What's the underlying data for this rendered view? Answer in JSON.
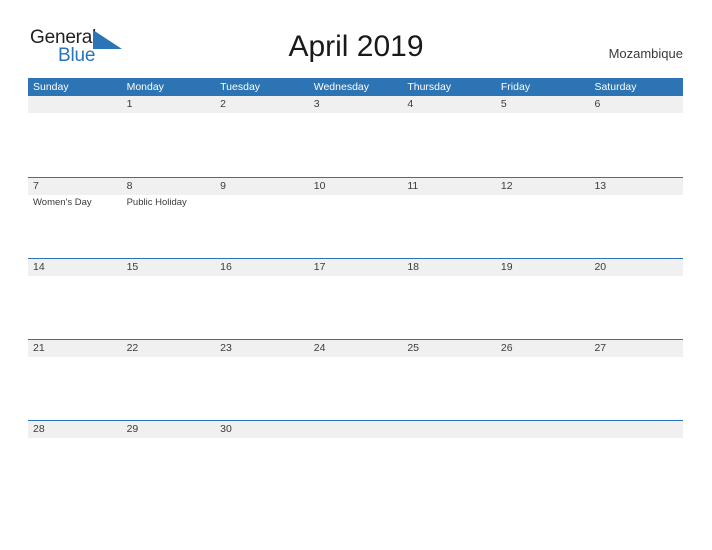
{
  "brand": {
    "name_part1": "General",
    "name_part2": "Blue",
    "triangle_color": "#2b74b8",
    "text_color": "#231f20"
  },
  "header": {
    "title": "April 2019",
    "country": "Mozambique"
  },
  "colors": {
    "header_blue": "#2c74b3",
    "row_divider_blue": "#2c74b3",
    "date_band_gray": "#f0f0f0",
    "text_gray": "#3b3b3b",
    "page_background": "#ffffff"
  },
  "calendar": {
    "month": "April",
    "year": "2019",
    "day_headers": [
      "Sunday",
      "Monday",
      "Tuesday",
      "Wednesday",
      "Thursday",
      "Friday",
      "Saturday"
    ],
    "weeks": [
      [
        {
          "date": "",
          "event": ""
        },
        {
          "date": "1",
          "event": ""
        },
        {
          "date": "2",
          "event": ""
        },
        {
          "date": "3",
          "event": ""
        },
        {
          "date": "4",
          "event": ""
        },
        {
          "date": "5",
          "event": ""
        },
        {
          "date": "6",
          "event": ""
        }
      ],
      [
        {
          "date": "7",
          "event": "Women's Day"
        },
        {
          "date": "8",
          "event": "Public Holiday"
        },
        {
          "date": "9",
          "event": ""
        },
        {
          "date": "10",
          "event": ""
        },
        {
          "date": "11",
          "event": ""
        },
        {
          "date": "12",
          "event": ""
        },
        {
          "date": "13",
          "event": ""
        }
      ],
      [
        {
          "date": "14",
          "event": ""
        },
        {
          "date": "15",
          "event": ""
        },
        {
          "date": "16",
          "event": ""
        },
        {
          "date": "17",
          "event": ""
        },
        {
          "date": "18",
          "event": ""
        },
        {
          "date": "19",
          "event": ""
        },
        {
          "date": "20",
          "event": ""
        }
      ],
      [
        {
          "date": "21",
          "event": ""
        },
        {
          "date": "22",
          "event": ""
        },
        {
          "date": "23",
          "event": ""
        },
        {
          "date": "24",
          "event": ""
        },
        {
          "date": "25",
          "event": ""
        },
        {
          "date": "26",
          "event": ""
        },
        {
          "date": "27",
          "event": ""
        }
      ],
      [
        {
          "date": "28",
          "event": ""
        },
        {
          "date": "29",
          "event": ""
        },
        {
          "date": "30",
          "event": ""
        },
        {
          "date": "",
          "event": ""
        },
        {
          "date": "",
          "event": ""
        },
        {
          "date": "",
          "event": ""
        },
        {
          "date": "",
          "event": ""
        }
      ]
    ]
  }
}
